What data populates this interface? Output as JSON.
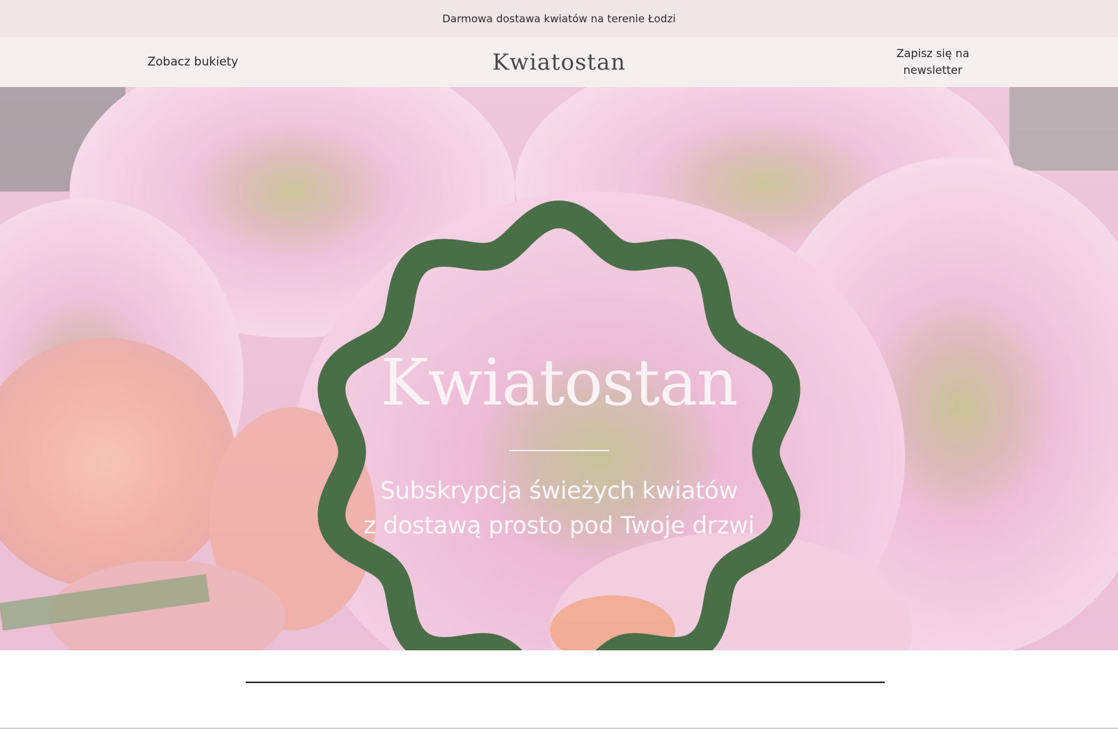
{
  "announcement": {
    "text": "Darmowa dostawa kwiatów na terenie Łodzi"
  },
  "header": {
    "nav_left": "Zobacz bukiety",
    "logo": "Kwiatostan",
    "nav_right": "Zapisz się na newsletter"
  },
  "hero": {
    "title": "Kwiatostan",
    "subtitle_line1": "Subskrypcja świeżych kwiatów",
    "subtitle_line2": "z dostawą prosto pod Twoje drzwi"
  },
  "colors": {
    "announcement_bg": "#efe6e7",
    "header_bg": "#f5efef",
    "badge_green": "#4a6e48",
    "hero_text": "#fbf2f5"
  }
}
